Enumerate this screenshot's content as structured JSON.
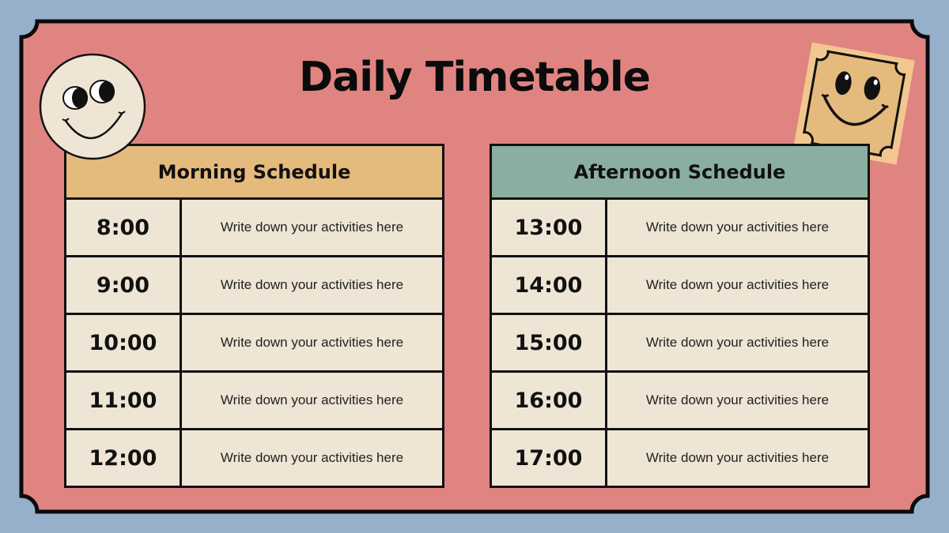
{
  "title": "Daily Timetable",
  "colors": {
    "background": "#96B0CB",
    "frame": "#E08482",
    "morning_header": "#E5BA7D",
    "afternoon_header": "#8AAE9F",
    "cell": "#EEE5D5",
    "outline": "#111111"
  },
  "decorations": {
    "left": "round-smiley-face-icon",
    "right": "ticket-smiley-face-icon"
  },
  "morning": {
    "heading": "Morning Schedule",
    "rows": [
      {
        "time": "8:00",
        "activity": "Write down your activities here"
      },
      {
        "time": "9:00",
        "activity": "Write down your activities here"
      },
      {
        "time": "10:00",
        "activity": "Write down your activities here"
      },
      {
        "time": "11:00",
        "activity": "Write down your activities here"
      },
      {
        "time": "12:00",
        "activity": "Write down your activities here"
      }
    ]
  },
  "afternoon": {
    "heading": "Afternoon Schedule",
    "rows": [
      {
        "time": "13:00",
        "activity": "Write down your activities here"
      },
      {
        "time": "14:00",
        "activity": "Write down your activities here"
      },
      {
        "time": "15:00",
        "activity": "Write down your activities here"
      },
      {
        "time": "16:00",
        "activity": "Write down your activities here"
      },
      {
        "time": "17:00",
        "activity": "Write down your activities here"
      }
    ]
  }
}
